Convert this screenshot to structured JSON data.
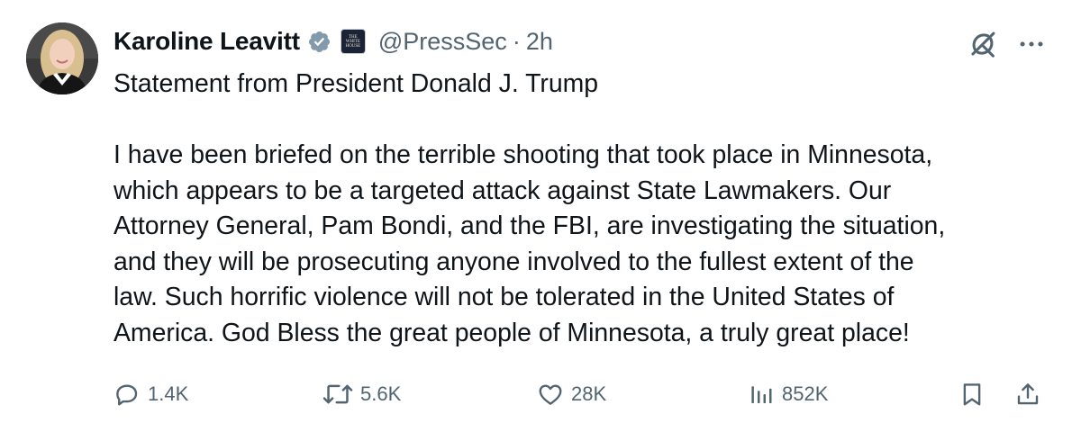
{
  "author": {
    "display_name": "Karoline Leavitt",
    "handle": "@PressSec",
    "separator": "·",
    "timestamp": "2h",
    "affiliate_badge_text": [
      "THE",
      "WHITE",
      "HOUSE"
    ]
  },
  "post": {
    "heading": "Statement from President Donald J. Trump",
    "lines": [
      "I have been briefed on the terrible shooting that took place in Minnesota,",
      "which appears to be a targeted attack against State Lawmakers. Our",
      "Attorney General, Pam Bondi, and the FBI, are investigating the situation,",
      "and they will be prosecuting anyone involved to the fullest extent of the",
      "law. Such horrific violence will not be tolerated in the United States of",
      "America. God Bless the great people of Minnesota, a truly great place!"
    ]
  },
  "metrics": {
    "replies": "1.4K",
    "reposts": "5.6K",
    "likes": "28K",
    "views": "852K"
  },
  "icons": {
    "verified": "verified-badge-icon",
    "grok": "grok-icon",
    "more": "more-icon",
    "reply": "reply-icon",
    "repost": "repost-icon",
    "like": "heart-icon",
    "views": "views-icon",
    "bookmark": "bookmark-icon",
    "share": "share-icon"
  },
  "colors": {
    "text": "#0f1419",
    "secondary": "#536471",
    "verified_gray": "#829aab"
  }
}
